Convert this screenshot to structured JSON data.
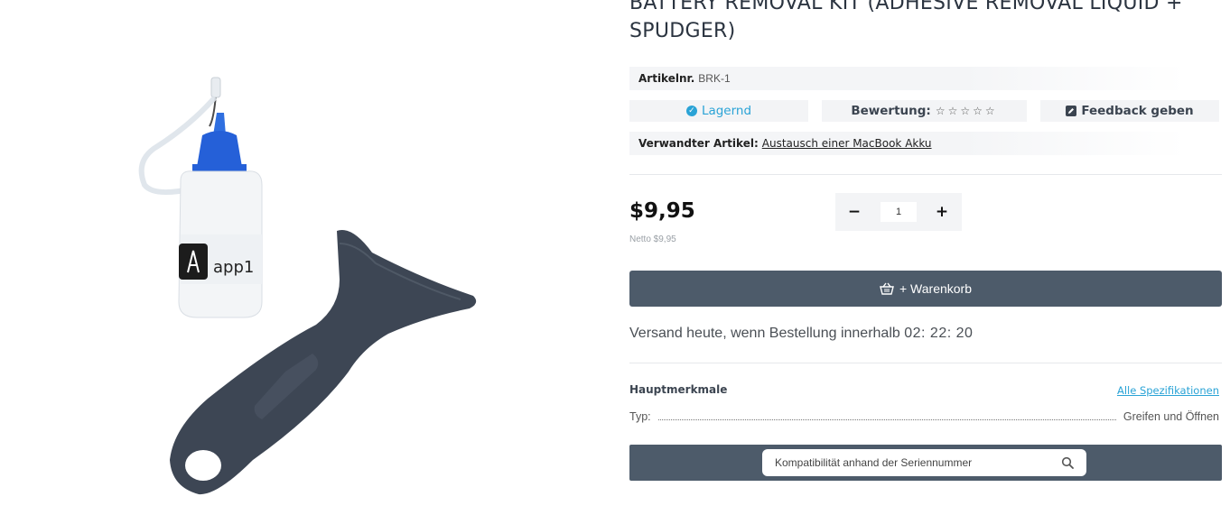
{
  "product": {
    "title": "BATTERY REMOVAL KIT (ADHESIVE REMOVAL LIQUID + SPUDGER)",
    "image_brand_text": "app1",
    "sku_label": "Artikelnr.",
    "sku_value": "BRK-1",
    "stock_label": "Lagernd",
    "rating_label": "Bewertung:",
    "rating_stars": "☆☆☆☆☆",
    "rating_value": 0,
    "rating_max": 5,
    "feedback_label": "Feedback geben",
    "related_label": "Verwandter Artikel:",
    "related_link": "Austausch einer MacBook Akku",
    "price": "$9,95",
    "netto": "Netto $9,95",
    "quantity": "1",
    "qty_minus": "−",
    "qty_plus": "+",
    "cart_label": "+ Warenkorb",
    "shipping_text": "Versand heute, wenn Bestellung innerhalb",
    "countdown": "02: 22: 20",
    "features_title": "Hauptmerkmale",
    "all_specs_link": "Alle Spezifikationen",
    "specs": [
      {
        "label": "Typ:",
        "value": "Greifen und Öffnen"
      }
    ],
    "compat_placeholder": "Kompatibilität anhand der Seriennummer"
  },
  "icons": {
    "stock": "check-circle-icon",
    "feedback": "edit-icon",
    "cart": "basket-icon",
    "search": "search-icon"
  },
  "colors": {
    "accent": "#2aa3d6",
    "button_bg": "#4d5b6a",
    "pill_bg": "#f3f4f6"
  }
}
